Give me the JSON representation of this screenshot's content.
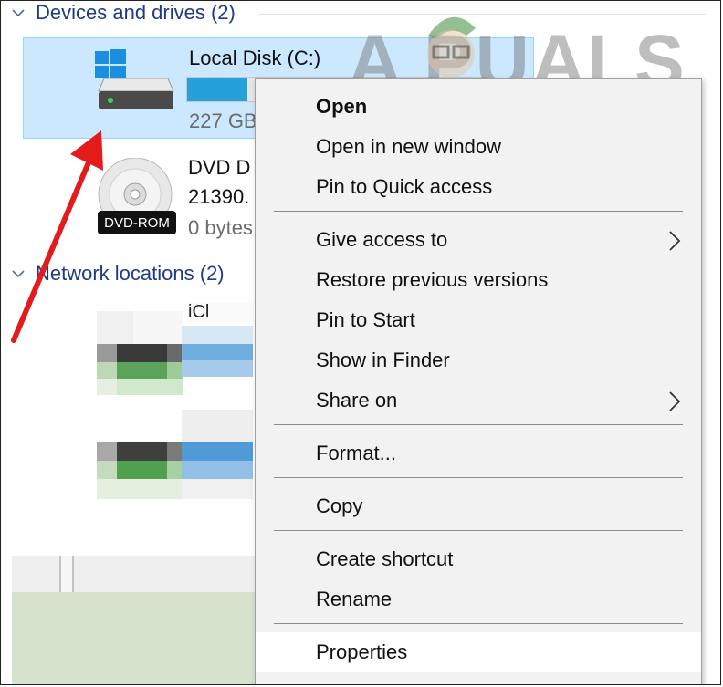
{
  "explorer": {
    "devices_header": "Devices and drives (2)",
    "network_header": "Network locations (2)",
    "local_disk": {
      "name": "Local Disk (C:)",
      "free_text": "227 GB",
      "usage_fraction": 0.2
    },
    "dvd": {
      "name": "DVD D",
      "line2": "21390.",
      "line3": "0 bytes",
      "badge": "DVD-ROM"
    },
    "network_item_1_name": "iCl"
  },
  "watermark": "A  PUALS",
  "context_menu": {
    "items": [
      {
        "label": "Open",
        "bold": true
      },
      {
        "label": "Open in new window"
      },
      {
        "label": "Pin to Quick access"
      },
      {
        "label": "Give access to",
        "submenu": true
      },
      {
        "label": "Restore previous versions"
      },
      {
        "label": "Pin to Start"
      },
      {
        "label": "Show in Finder"
      },
      {
        "label": "Share on",
        "submenu": true
      },
      {
        "label": "Format..."
      },
      {
        "label": "Copy"
      },
      {
        "label": "Create shortcut"
      },
      {
        "label": "Rename"
      },
      {
        "label": "Properties",
        "highlighted": true
      }
    ]
  },
  "icons": {
    "windows_logo": "windows-logo-icon",
    "drive": "hard-drive-icon",
    "dvd": "dvd-disc-icon",
    "submenu_arrow": "chevron-right-icon",
    "annotation": "red-arrow-annotation"
  },
  "colors": {
    "selection": "#cce8ff",
    "header_text": "#1e3a8a",
    "usage_bar": "#26a0da",
    "annotation": "#e31b1b",
    "menu_bg": "#f2f2f2"
  }
}
